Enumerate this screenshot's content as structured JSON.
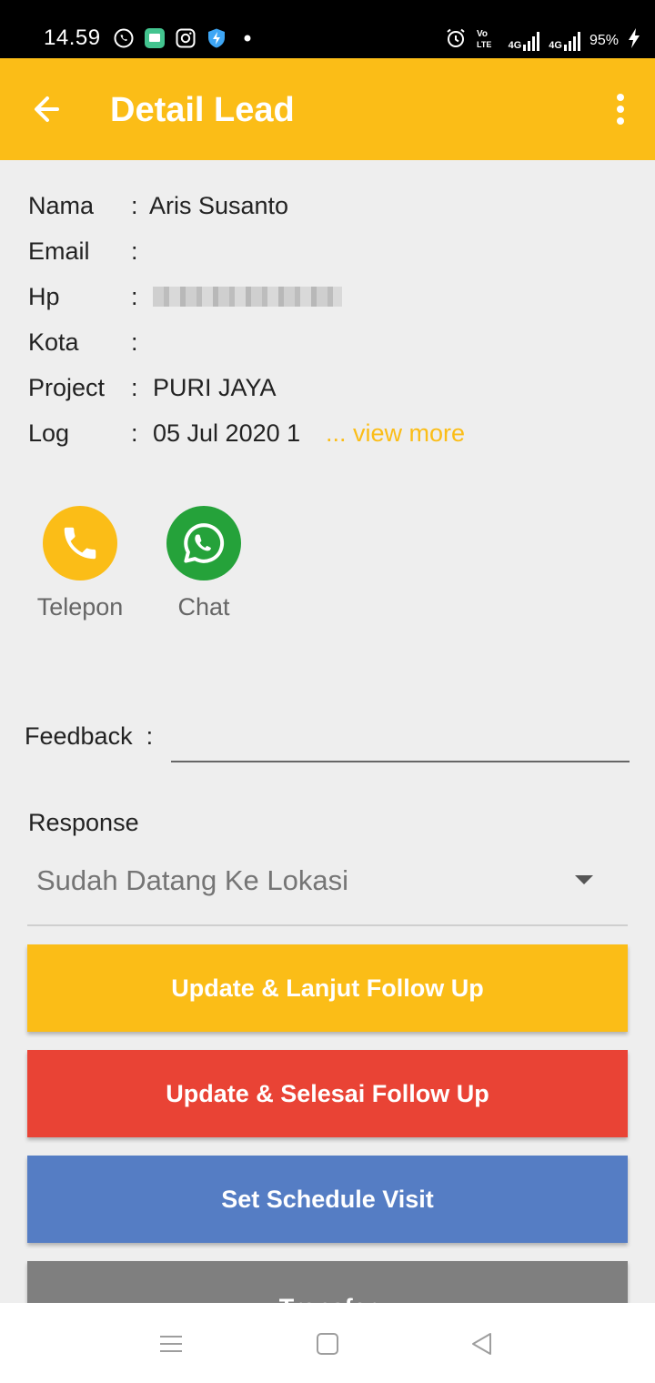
{
  "status_bar": {
    "time": "14.59",
    "battery": "95%",
    "left_icons": [
      "whatsapp-icon",
      "message-icon",
      "instagram-icon",
      "shield-icon",
      "dot-icon"
    ],
    "right_icons": [
      "alarm-icon",
      "volte-icon",
      "4g-signal-icon",
      "4g-signal-icon",
      "battery-charging-icon"
    ],
    "network_1": "4G",
    "network_2": "4G"
  },
  "app_bar": {
    "title": "Detail Lead",
    "back_icon": "arrow-left-icon",
    "menu_icon": "more-vert-icon",
    "background": "#fbbd17"
  },
  "lead": {
    "rows": [
      {
        "label": "Nama",
        "value": "Aris Susanto"
      },
      {
        "label": "Email",
        "value": ""
      },
      {
        "label": "Hp",
        "value": ""
      },
      {
        "label": "Kota",
        "value": ""
      },
      {
        "label": "Project",
        "value": "PURI JAYA"
      },
      {
        "label": "Log",
        "value": "05 Jul 2020 1"
      }
    ],
    "separator": ":",
    "view_more": "... view more"
  },
  "actions": {
    "phone": {
      "label": "Telepon",
      "icon": "phone-icon",
      "color": "#fbbd17"
    },
    "chat": {
      "label": "Chat",
      "icon": "whatsapp-icon",
      "color": "#25a23a"
    }
  },
  "feedback": {
    "label": "Feedback",
    "separator": ":",
    "value": ""
  },
  "response": {
    "label": "Response",
    "selected": "Sudah Datang Ke Lokasi"
  },
  "buttons": {
    "update_continue": {
      "label": "Update & Lanjut Follow Up",
      "color": "#fbbd17"
    },
    "update_finish": {
      "label": "Update & Selesai Follow Up",
      "color": "#e94335"
    },
    "schedule": {
      "label": "Set Schedule Visit",
      "color": "#557dc4"
    },
    "transfer": {
      "label": "Transfer",
      "color": "#7f7f7f"
    }
  },
  "nav_bar": {
    "icons": [
      "menu-icon",
      "home-square-icon",
      "back-triangle-icon"
    ]
  }
}
